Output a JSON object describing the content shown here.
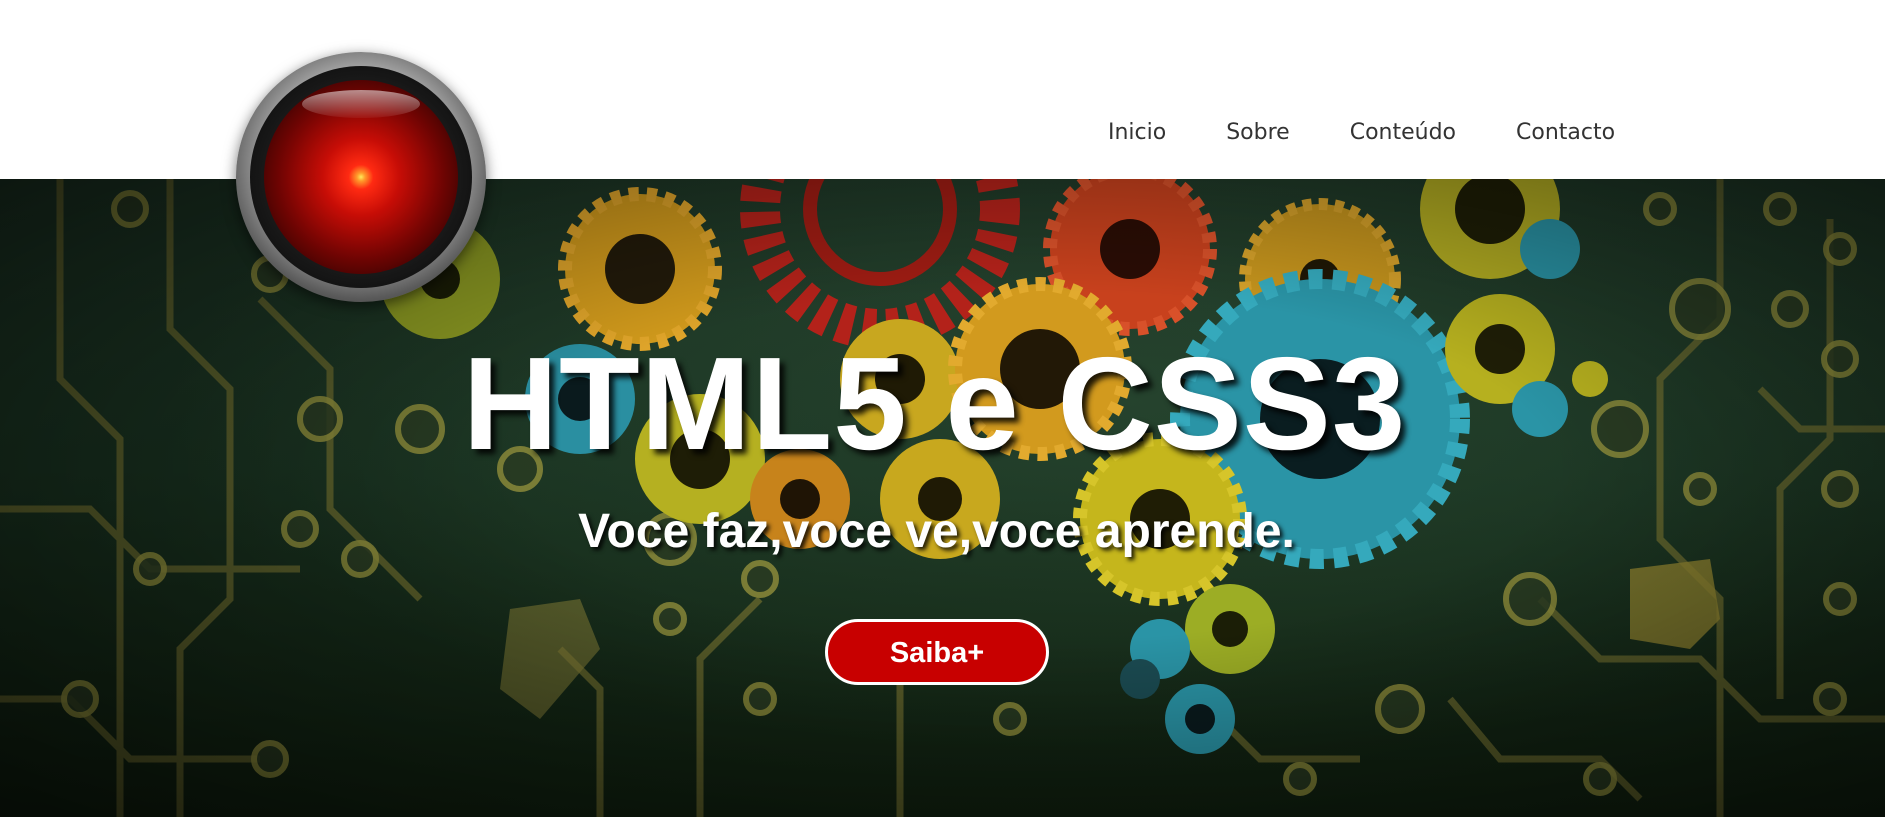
{
  "header": {
    "logo_icon": "hal-eye-logo",
    "nav": {
      "items": [
        {
          "label": "Inicio"
        },
        {
          "label": "Sobre"
        },
        {
          "label": "Conteúdo"
        },
        {
          "label": "Contacto"
        }
      ]
    }
  },
  "hero": {
    "background_icon": "gears-and-circuit-board-image",
    "title": "HTML5 e CSS3",
    "subtitle": "Voce faz,voce ve,voce aprende.",
    "cta_label": "Saiba+"
  },
  "colors": {
    "header_bg": "#ffffff",
    "nav_text": "#333333",
    "accent_red": "#c80000",
    "hero_bg": "#18301f",
    "text_white": "#ffffff"
  }
}
